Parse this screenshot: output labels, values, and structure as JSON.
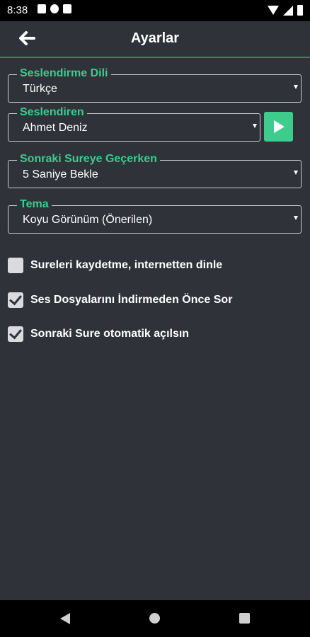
{
  "status_bar": {
    "time": "8:38"
  },
  "header": {
    "title": "Ayarlar",
    "back_icon": "arrow-left-icon"
  },
  "settings": {
    "language": {
      "label": "Seslendirme Dili",
      "value": "Türkçe"
    },
    "reciter": {
      "label": "Seslendiren",
      "value": "Ahmet Deniz"
    },
    "next_surah": {
      "label": "Sonraki Sureye Geçerken",
      "value": "5 Saniye Bekle"
    },
    "theme": {
      "label": "Tema",
      "value": "Koyu Görünüm (Önerilen)"
    }
  },
  "options": [
    {
      "label": "Sureleri kaydetme, internetten dinle",
      "checked": false
    },
    {
      "label": "Ses Dosyalarını İndirmeden Önce Sor",
      "checked": true
    },
    {
      "label": "Sonraki Sure otomatik açılsın",
      "checked": true
    }
  ],
  "colors": {
    "background": "#2f3238",
    "accent": "#3ecb8e",
    "divider": "#2e8b57"
  }
}
